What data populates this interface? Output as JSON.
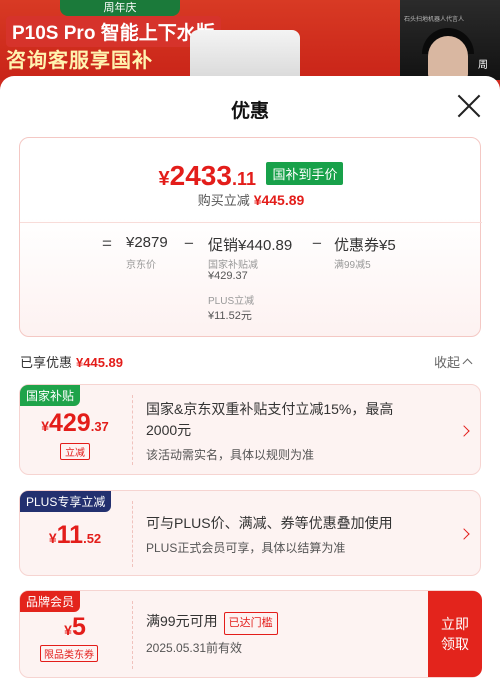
{
  "banner": {
    "anniversary": "周年庆",
    "headline": "P10S Pro 智能上下水版",
    "subheadline": "咨询客服享国补",
    "tiny_caption": "石头扫地机器人代言人",
    "name_partial": "周"
  },
  "sheet": {
    "title": "优惠"
  },
  "price_card": {
    "final_currency": "¥",
    "final_int": "2433",
    "final_dec": ".11",
    "final_tag": "国补到手价",
    "cut_label": "购买立减",
    "cut_value": "¥445.89",
    "eq": "=",
    "jd_price": "¥2879",
    "jd_label": "京东价",
    "minus1": "−",
    "promo": "促销¥440.89",
    "promo_sub1_label": "国家补贴减",
    "promo_sub1_value": "¥429.37",
    "promo_sub2_label": "PLUS立减",
    "promo_sub2_value": "¥11.52元",
    "minus2": "−",
    "coupon": "优惠券¥5",
    "coupon_sub": "满99减5"
  },
  "enjoyed": {
    "label": "已享优惠",
    "value": "¥445.89",
    "collapse": "收起"
  },
  "coupons": [
    {
      "badge": "国家补贴",
      "badge_color": "#1fa34a",
      "currency": "¥",
      "int": "429",
      "dec": ".37",
      "stamp": "立减",
      "desc_line1": "国家&京东双重补贴支付立减15%，最高",
      "desc_line2": "2000元",
      "desc_sub": "该活动需实名，具体以规则为准"
    },
    {
      "badge": "PLUS专享立减",
      "badge_color": "#23306f",
      "currency": "¥",
      "int": "11",
      "dec": ".52",
      "desc_line1": "可与PLUS价、满减、券等优惠叠加使用",
      "desc_sub": "PLUS正式会员可享，具体以结算为准"
    },
    {
      "badge": "品牌会员",
      "badge_color": "#e3241c",
      "currency": "¥",
      "int": "5",
      "stamp": "限品类东券",
      "desc_line1": "满99元可用",
      "status": "已达门槛",
      "desc_sub": "2025.05.31前有效",
      "claim": "立即领取"
    }
  ]
}
